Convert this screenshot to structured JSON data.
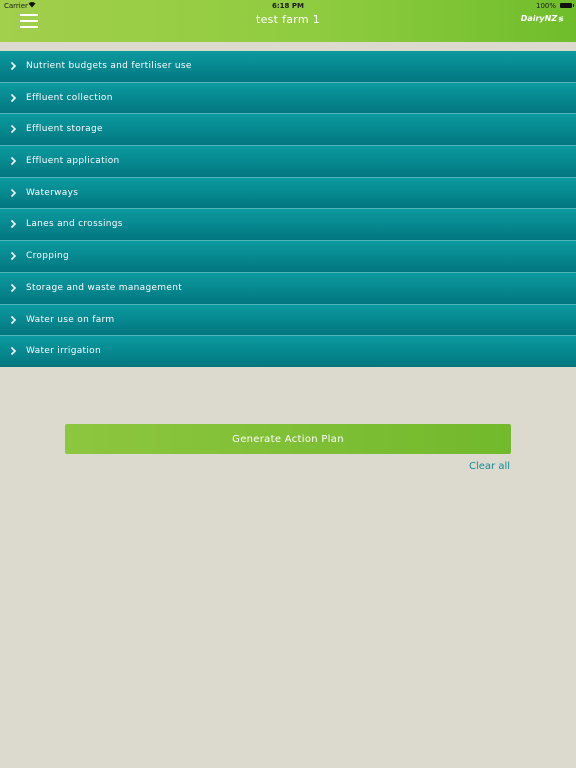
{
  "status_bar": {
    "carrier": "Carrier",
    "time": "6:18 PM",
    "battery": "100%"
  },
  "header": {
    "title": "test farm 1",
    "logo": "DairyNZ",
    "accent_color": "#8fcc3f"
  },
  "menu": {
    "items": [
      {
        "label": "Nutrient budgets and fertiliser use"
      },
      {
        "label": "Effluent collection"
      },
      {
        "label": "Effluent storage"
      },
      {
        "label": "Effluent application"
      },
      {
        "label": "Waterways"
      },
      {
        "label": "Lanes and crossings"
      },
      {
        "label": "Cropping"
      },
      {
        "label": "Storage and waste management"
      },
      {
        "label": "Water use on farm"
      },
      {
        "label": "Water irrigation"
      }
    ],
    "item_color": "#078c93"
  },
  "actions": {
    "generate_label": "Generate Action Plan",
    "clear_label": "Clear all"
  }
}
